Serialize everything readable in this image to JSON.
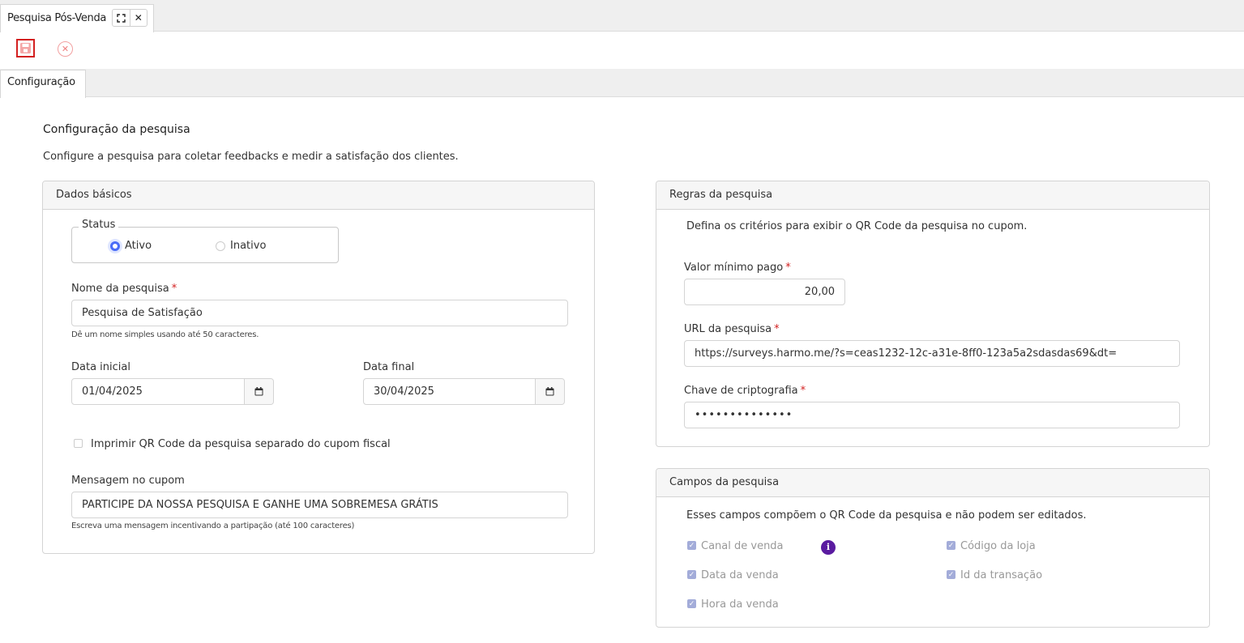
{
  "window": {
    "tab_title": "Pesquisa Pós-Venda",
    "expand_icon": "expand-icon",
    "close_icon": "close-icon",
    "close_glyph": "✕"
  },
  "toolbar": {
    "save_icon": "save-icon",
    "cancel_icon": "cancel-icon",
    "cancel_glyph": "✕"
  },
  "subtabs": [
    {
      "label": "Configuração",
      "active": true
    }
  ],
  "page": {
    "title": "Configuração da pesquisa",
    "description": "Configure a pesquisa para coletar feedbacks e medir a satisfação dos clientes."
  },
  "basic": {
    "header": "Dados básicos",
    "status": {
      "legend": "Status",
      "options": [
        {
          "label": "Ativo",
          "selected": true
        },
        {
          "label": "Inativo",
          "selected": false
        }
      ]
    },
    "name": {
      "label": "Nome da pesquisa",
      "required_mark": "*",
      "value": "Pesquisa de Satisfação",
      "hint": "Dê um nome simples usando até 50 caracteres."
    },
    "start_date": {
      "label": "Data inicial",
      "value": "01/04/2025"
    },
    "end_date": {
      "label": "Data final",
      "value": "30/04/2025"
    },
    "print_qr": {
      "label": "Imprimir QR Code da pesquisa separado do cupom fiscal",
      "checked": false
    },
    "message": {
      "label": "Mensagem no cupom",
      "value": "PARTICIPE DA NOSSA PESQUISA E GANHE UMA SOBREMESA GRÁTIS",
      "hint": "Escreva uma mensagem incentivando a partipação (até 100 caracteres)"
    }
  },
  "rules": {
    "header": "Regras da pesquisa",
    "description": "Defina os critérios para exibir o QR Code da pesquisa no cupom.",
    "min_value": {
      "label": "Valor mínimo pago",
      "required_mark": "*",
      "value": "20,00"
    },
    "url": {
      "label": "URL da pesquisa",
      "required_mark": "*",
      "value": "https://surveys.harmo.me/?s=ceas1232-12c-a31e-8ff0-123a5a2sdasdas69&dt="
    },
    "key": {
      "label": "Chave de criptografia",
      "required_mark": "*",
      "value": "••••••••••••••"
    }
  },
  "fields": {
    "header": "Campos da pesquisa",
    "description": "Esses campos compõem o QR Code da pesquisa e não podem ser editados.",
    "info_glyph": "i",
    "items": [
      {
        "label": "Canal de venda",
        "checked": true
      },
      {
        "label": "Código da loja",
        "checked": true
      },
      {
        "label": "Data da venda",
        "checked": true
      },
      {
        "label": "Id da transação",
        "checked": true
      },
      {
        "label": "Hora da venda",
        "checked": true
      }
    ],
    "check_glyph": "✓"
  },
  "colors": {
    "accent": "#4a6cf7",
    "required": "#d32020",
    "info": "#5a1ba0",
    "disabled_check": "#a3acd9"
  }
}
